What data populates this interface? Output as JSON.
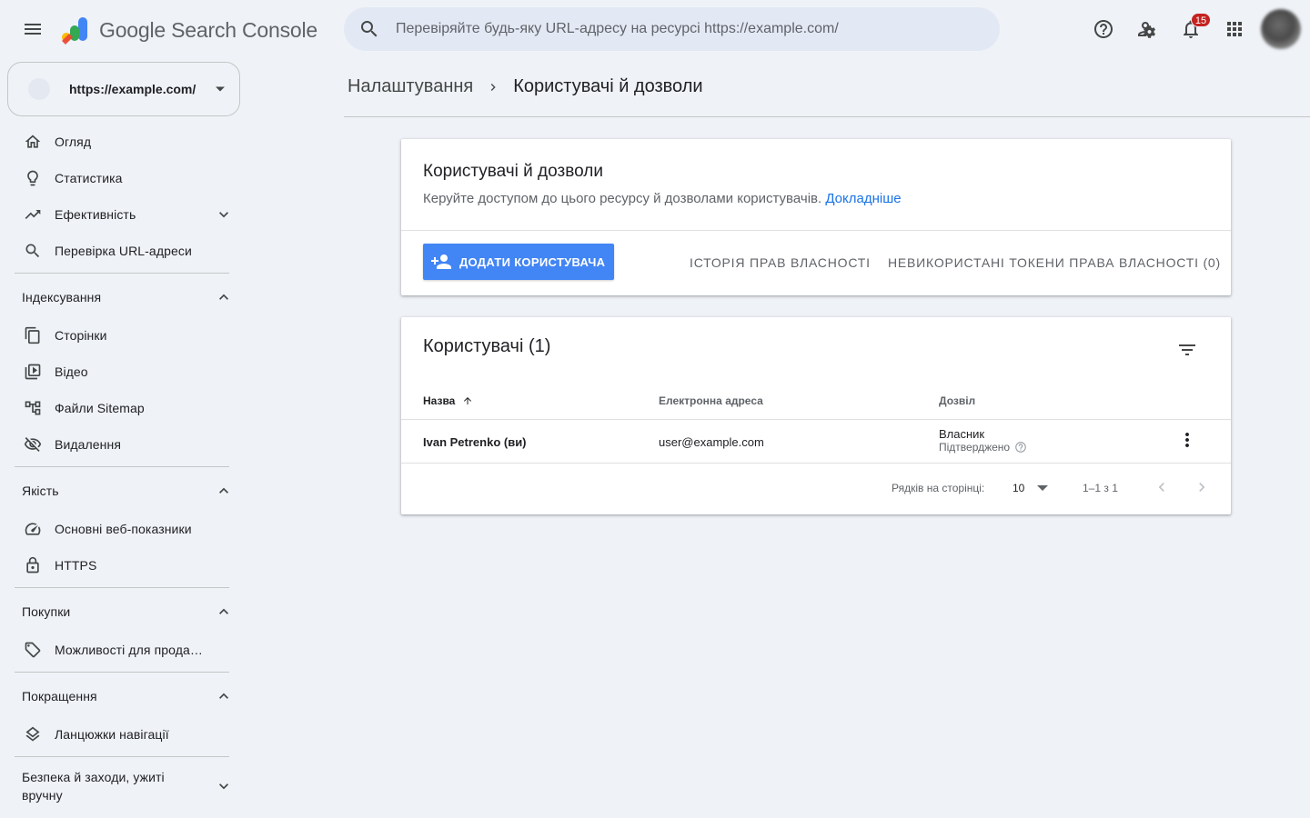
{
  "app": {
    "title": "Google Search Console"
  },
  "search": {
    "placeholder": "Перевіряйте будь-яку URL-адресу на ресурсі https://example.com/"
  },
  "topbar": {
    "notifications_count": "15"
  },
  "property": {
    "url": "https://example.com/"
  },
  "sidebar": {
    "top_items": [
      {
        "label": "Огляд",
        "icon": "home-icon"
      },
      {
        "label": "Статистика",
        "icon": "lightbulb-icon"
      },
      {
        "label": "Ефективність",
        "icon": "trending-up-icon",
        "expandable": true
      },
      {
        "label": "Перевірка URL-адреси",
        "icon": "search-icon"
      }
    ],
    "sections": [
      {
        "title": "Індексування",
        "expanded": true,
        "items": [
          {
            "label": "Сторінки",
            "icon": "pages-icon"
          },
          {
            "label": "Відео",
            "icon": "video-icon"
          },
          {
            "label": "Файли Sitemap",
            "icon": "sitemap-icon"
          },
          {
            "label": "Видалення",
            "icon": "visibility-off-icon"
          }
        ]
      },
      {
        "title": "Якість",
        "expanded": true,
        "items": [
          {
            "label": "Основні веб-показники",
            "icon": "speed-icon"
          },
          {
            "label": "HTTPS",
            "icon": "lock-icon"
          }
        ]
      },
      {
        "title": "Покупки",
        "expanded": true,
        "items": [
          {
            "label": "Можливості для прода…",
            "icon": "tag-icon"
          }
        ]
      },
      {
        "title": "Покращення",
        "expanded": true,
        "items": [
          {
            "label": "Ланцюжки навігації",
            "icon": "layers-icon"
          }
        ]
      },
      {
        "title": "Безпека й заходи, ужиті вручну",
        "expanded": false,
        "items": []
      }
    ]
  },
  "breadcrumb": {
    "parent": "Налаштування",
    "current": "Користувачі й дозволи"
  },
  "intro_card": {
    "title": "Користувачі й дозволи",
    "description": "Керуйте доступом до цього ресурсу й дозволами користувачів.",
    "learn_more": "Докладніше",
    "add_user": "ДОДАТИ КОРИСТУВАЧА",
    "ownership_history": "ІСТОРІЯ ПРАВ ВЛАСНОСТІ",
    "unused_tokens": "НЕВИКОРИСТАНІ ТОКЕНИ ПРАВА ВЛАСНОСТІ (0)"
  },
  "users_card": {
    "title": "Користувачі (1)",
    "columns": {
      "name": "Назва",
      "email": "Електронна адреса",
      "permission": "Дозвіл"
    },
    "rows": [
      {
        "name": "Ivan Petrenko (ви)",
        "email": "user@example.com",
        "permission": "Власник",
        "status": "Підтверджено"
      }
    ],
    "pagination": {
      "rows_label": "Рядків на сторінці:",
      "rows_per_page": "10",
      "range": "1–1 з 1"
    }
  },
  "colors": {
    "accent": "#4285f4",
    "link": "#1a73e8",
    "background": "#eff2f7",
    "badge": "#c5221f"
  }
}
